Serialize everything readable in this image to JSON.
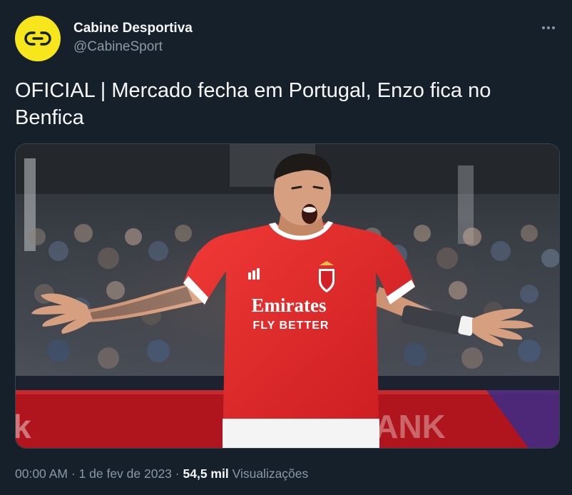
{
  "author": {
    "display_name": "Cabine Desportiva",
    "handle": "@CabineSport",
    "avatar_icon": "cabine-logo-icon",
    "avatar_color": "#f6e61b"
  },
  "tweet": {
    "text": "OFICIAL | Mercado fecha em Portugal, Enzo fica no Benfica"
  },
  "media": {
    "shirt_sponsor_line1": "Emirates",
    "shirt_sponsor_line2": "FLY BETTER",
    "board_text_left": "k",
    "board_text_right": "BANK"
  },
  "meta": {
    "time": "00:00 AM",
    "separator": "·",
    "date": "1 de fev de 2023",
    "views_count": "54,5 mil",
    "views_label": "Visualizações"
  },
  "colors": {
    "background": "#15202b",
    "text_primary": "#f7f9f9",
    "text_secondary": "#8b98a5",
    "border": "#38444d",
    "benfica_red": "#e31b23"
  },
  "icons": {
    "more": "more-horizontal-icon"
  }
}
